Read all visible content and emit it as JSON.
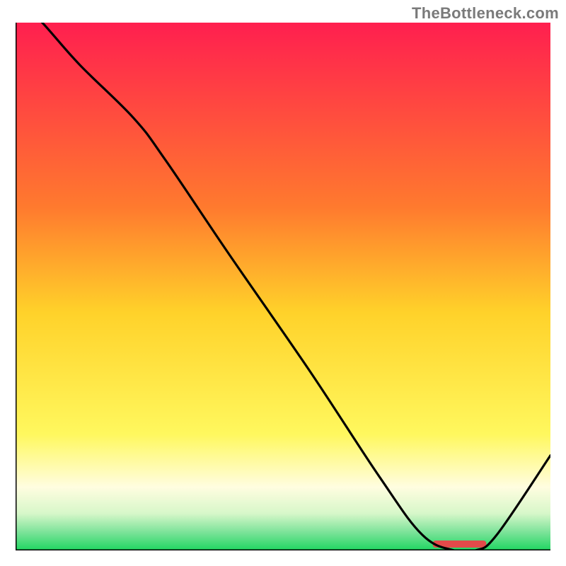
{
  "watermark": "TheBottleneck.com",
  "marker_label": "",
  "colors": {
    "top": "#ff1f4f",
    "mid": "#ffd22a",
    "lower": "#fffde0",
    "bottom_pale": "#d7f7c9",
    "bottom": "#1fd661",
    "curve": "#000000",
    "marker": "#e34a4a",
    "axis": "#000000"
  },
  "chart_data": {
    "type": "line",
    "title": "",
    "xlabel": "",
    "ylabel": "",
    "xlim": [
      0,
      100
    ],
    "ylim": [
      0,
      100
    ],
    "x": [
      0,
      5,
      12,
      22,
      28,
      40,
      55,
      68,
      76,
      82,
      86,
      90,
      100
    ],
    "values": [
      105,
      100,
      92,
      82,
      74,
      56,
      34,
      14,
      3,
      0,
      0,
      3,
      18
    ],
    "optimum_range_x": [
      78,
      88
    ],
    "gradient_stops": [
      {
        "pos": 0.0,
        "color": "#ff1f4f"
      },
      {
        "pos": 0.35,
        "color": "#ff7a2e"
      },
      {
        "pos": 0.55,
        "color": "#ffd22a"
      },
      {
        "pos": 0.78,
        "color": "#fff85e"
      },
      {
        "pos": 0.88,
        "color": "#fffde0"
      },
      {
        "pos": 0.93,
        "color": "#d7f7c9"
      },
      {
        "pos": 0.965,
        "color": "#7de39a"
      },
      {
        "pos": 1.0,
        "color": "#1fd661"
      }
    ]
  }
}
